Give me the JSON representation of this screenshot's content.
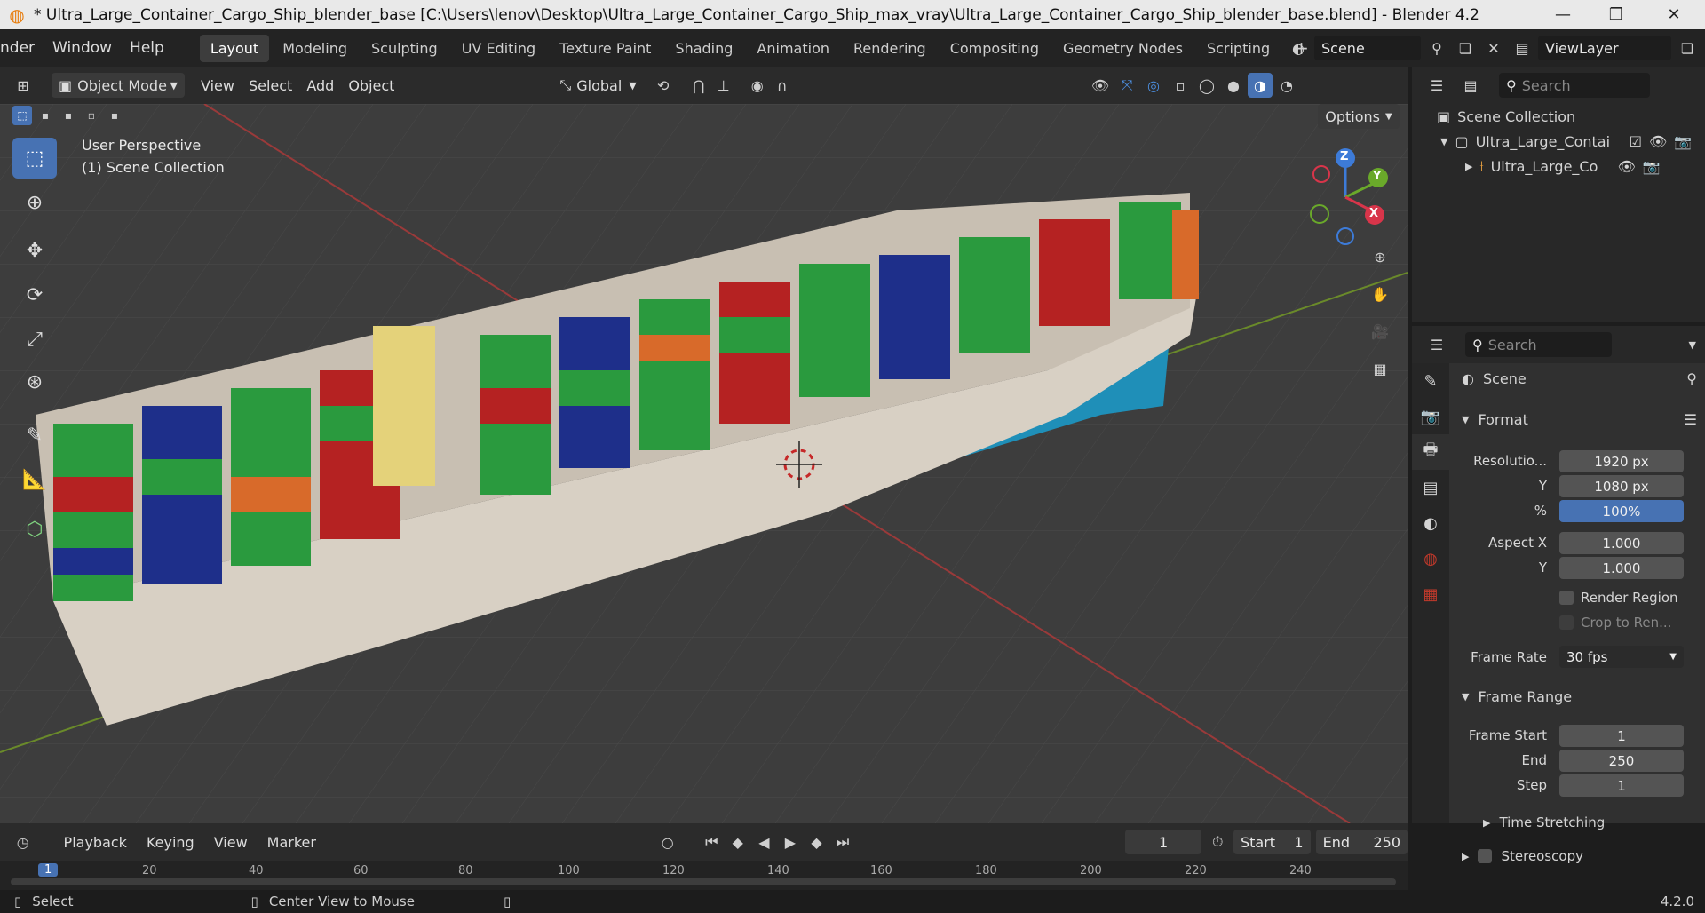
{
  "titlebar": {
    "title": "* Ultra_Large_Container_Cargo_Ship_blender_base [C:\\Users\\lenov\\Desktop\\Ultra_Large_Container_Cargo_Ship_max_vray\\Ultra_Large_Container_Cargo_Ship_blender_base.blend] - Blender 4.2",
    "minimize": "—",
    "maximize": "❐",
    "close": "✕"
  },
  "menubar": {
    "menus": [
      "nder",
      "Window",
      "Help"
    ],
    "workspaces": [
      "Layout",
      "Modeling",
      "Sculpting",
      "UV Editing",
      "Texture Paint",
      "Shading",
      "Animation",
      "Rendering",
      "Compositing",
      "Geometry Nodes",
      "Scripting"
    ],
    "active_workspace": "Layout",
    "add_tab": "+",
    "scene_value": "Scene",
    "viewlayer_value": "ViewLayer"
  },
  "viewport_header": {
    "mode": "Object Mode",
    "menus": [
      "View",
      "Select",
      "Add",
      "Object"
    ],
    "orientation": "Global",
    "options": "Options"
  },
  "viewport": {
    "perspective_label": "User Perspective",
    "collection_label": "(1) Scene Collection",
    "gizmo_axes": {
      "x": "X",
      "y": "Y",
      "z": "Z"
    }
  },
  "outliner": {
    "search_placeholder": "Search",
    "root": "Scene Collection",
    "items": [
      {
        "label": "Ultra_Large_Contai"
      },
      {
        "label": "Ultra_Large_Co"
      }
    ]
  },
  "properties": {
    "search_placeholder": "Search",
    "context": "Scene",
    "format_panel": "Format",
    "resolution_x_label": "Resolutio...",
    "resolution_x": "1920 px",
    "resolution_y_label": "Y",
    "resolution_y": "1080 px",
    "resolution_pct_label": "%",
    "resolution_pct": "100%",
    "aspect_x_label": "Aspect X",
    "aspect_x": "1.000",
    "aspect_y_label": "Y",
    "aspect_y": "1.000",
    "render_region": "Render Region",
    "crop": "Crop to Ren...",
    "frame_rate_label": "Frame Rate",
    "frame_rate": "30 fps",
    "frame_range_panel": "Frame Range",
    "frame_start_label": "Frame Start",
    "frame_start": "1",
    "end_label": "End",
    "end": "250",
    "step_label": "Step",
    "step": "1",
    "time_stretching": "Time Stretching",
    "stereoscopy": "Stereoscopy"
  },
  "timeline": {
    "menus": [
      "Playback",
      "Keying",
      "View",
      "Marker"
    ],
    "current_frame": "1",
    "start_label": "Start",
    "start": "1",
    "end_label": "End",
    "end": "250",
    "ruler": [
      "1",
      "20",
      "40",
      "60",
      "80",
      "100",
      "120",
      "140",
      "160",
      "180",
      "200",
      "220",
      "240"
    ]
  },
  "statusbar": {
    "select": "Select",
    "center_view": "Center View to Mouse",
    "version": "4.2.0"
  },
  "colors": {
    "accent": "#4772b3",
    "viewport_bg": "#3d3d3d",
    "hull": "#d8d0c4",
    "hull_bottom": "#1f8fb8"
  }
}
